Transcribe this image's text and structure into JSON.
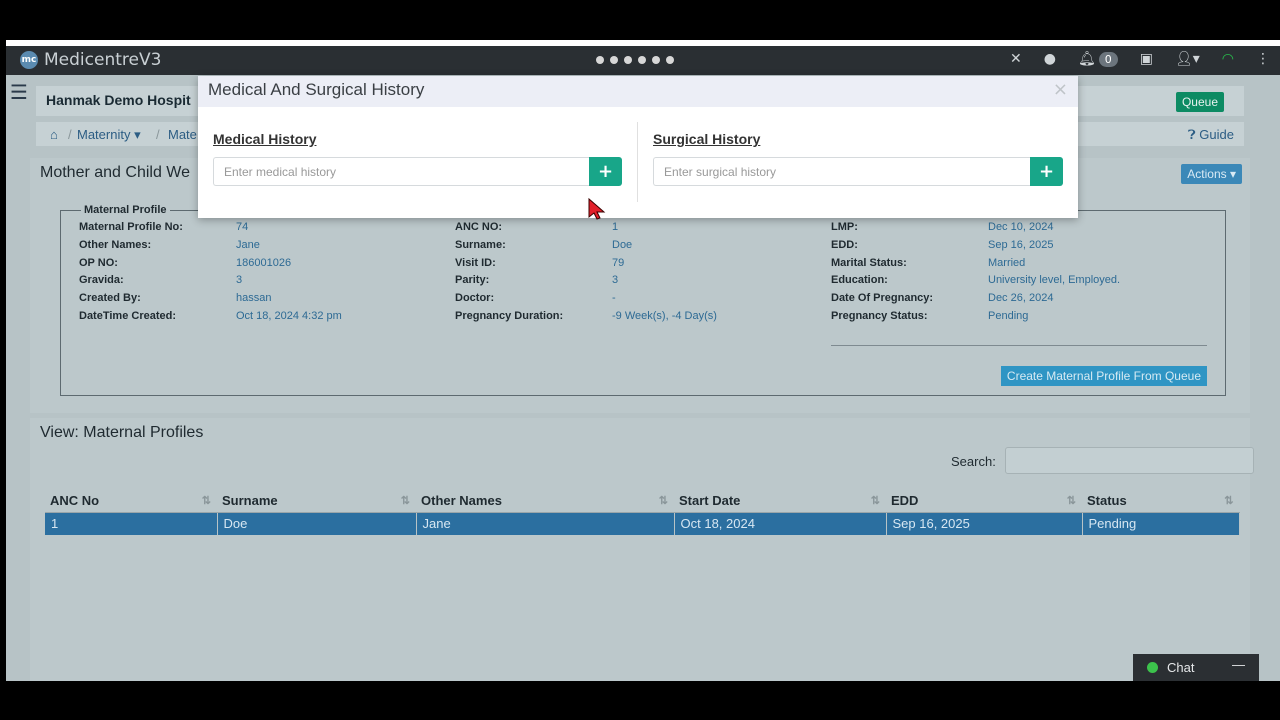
{
  "app": {
    "brand": "MedicentreV3",
    "brand_logo_text": "mc",
    "notification_count": "0"
  },
  "header": {
    "hospital_name": "Hanmak Demo Hospit",
    "queue_label": "Queue"
  },
  "breadcrumb": {
    "items": [
      "Maternity",
      "Mate"
    ],
    "guide_label": "Guide"
  },
  "panel": {
    "title": "Mother and Child We",
    "actions_label": "Actions",
    "legend": "Maternal Profile",
    "col1": [
      {
        "k": "Maternal Profile No:",
        "v": "74"
      },
      {
        "k": "Other Names:",
        "v": "Jane"
      },
      {
        "k": "OP NO:",
        "v": "186001026"
      },
      {
        "k": "Gravida:",
        "v": "3"
      },
      {
        "k": "Created By:",
        "v": "hassan"
      },
      {
        "k": "DateTime Created:",
        "v": "Oct 18, 2024 4:32 pm"
      }
    ],
    "col2": [
      {
        "k": "ANC NO:",
        "v": "1"
      },
      {
        "k": "Surname:",
        "v": "Doe"
      },
      {
        "k": "Visit ID:",
        "v": "79"
      },
      {
        "k": "Parity:",
        "v": "3"
      },
      {
        "k": "Doctor:",
        "v": "-"
      },
      {
        "k": "Pregnancy Duration:",
        "v": "-9 Week(s), -4 Day(s)"
      }
    ],
    "col3": [
      {
        "k": "LMP:",
        "v": "Dec 10, 2024"
      },
      {
        "k": "EDD:",
        "v": "Sep 16, 2025"
      },
      {
        "k": "Marital Status:",
        "v": "Married"
      },
      {
        "k": "Education:",
        "v": "University level, Employed."
      },
      {
        "k": "Date Of Pregnancy:",
        "v": "Dec 26, 2024"
      },
      {
        "k": "Pregnancy Status:",
        "v": "Pending"
      }
    ],
    "create_label": "Create Maternal Profile From Queue"
  },
  "list": {
    "title": "View: Maternal Profiles",
    "search_label": "Search:",
    "columns": [
      "ANC No",
      "Surname",
      "Other Names",
      "Start Date",
      "EDD",
      "Status"
    ],
    "rows": [
      [
        "1",
        "Doe",
        "Jane",
        "Oct 18, 2024",
        "Sep 16, 2025",
        "Pending"
      ]
    ]
  },
  "modal": {
    "title": "Medical And Surgical History",
    "close": "×",
    "medical_title": "Medical History",
    "medical_placeholder": "Enter medical history",
    "surgical_title": "Surgical History",
    "surgical_placeholder": "Enter surgical history",
    "add_symbol": "+"
  },
  "chat": {
    "label": "Chat",
    "minimize": "—"
  }
}
